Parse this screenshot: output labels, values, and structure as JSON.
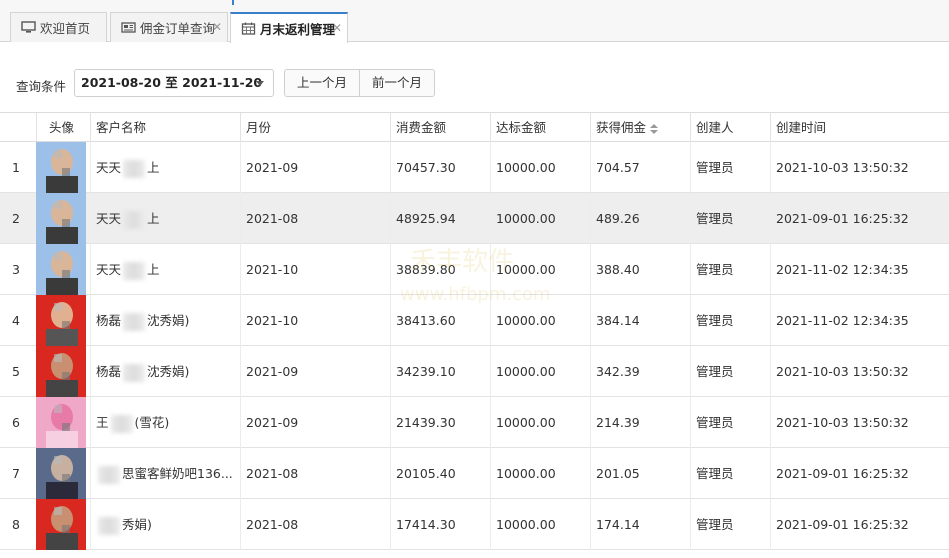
{
  "tabs": [
    {
      "label": "欢迎首页",
      "icon": "monitor-icon",
      "closable": false,
      "active": false
    },
    {
      "label": "佣金订单查询",
      "icon": "newspaper-icon",
      "closable": true,
      "active": false
    },
    {
      "label": "月末返利管理",
      "icon": "calendar-icon",
      "closable": true,
      "active": true
    }
  ],
  "toolbar": {
    "query_label": "查询条件",
    "date_range": "2021-08-20 至 2021-11-20",
    "prev_month_label": "上一个月",
    "next_month_label": "前一个月"
  },
  "table": {
    "headers": [
      "头像",
      "客户名称",
      "月份",
      "消费金额",
      "达标金额",
      "获得佣金",
      "创建人",
      "创建时间"
    ],
    "sorted_column": "获得佣金",
    "rows": [
      {
        "idx": "1",
        "name_a": "天天",
        "name_b": "上",
        "month": "2021-09",
        "spend": "70457.30",
        "target": "10000.00",
        "commission": "704.57",
        "creator": "管理员",
        "created": "2021-10-03 13:50:32"
      },
      {
        "idx": "2",
        "name_a": "天天",
        "name_b": "上",
        "month": "2021-08",
        "spend": "48925.94",
        "target": "10000.00",
        "commission": "489.26",
        "creator": "管理员",
        "created": "2021-09-01 16:25:32"
      },
      {
        "idx": "3",
        "name_a": "天天",
        "name_b": "上",
        "month": "2021-10",
        "spend": "38839.80",
        "target": "10000.00",
        "commission": "388.40",
        "creator": "管理员",
        "created": "2021-11-02 12:34:35"
      },
      {
        "idx": "4",
        "name_a": "杨磊",
        "name_b": "沈秀娟)",
        "month": "2021-10",
        "spend": "38413.60",
        "target": "10000.00",
        "commission": "384.14",
        "creator": "管理员",
        "created": "2021-11-02 12:34:35"
      },
      {
        "idx": "5",
        "name_a": "杨磊",
        "name_b": "沈秀娟)",
        "month": "2021-09",
        "spend": "34239.10",
        "target": "10000.00",
        "commission": "342.39",
        "creator": "管理员",
        "created": "2021-10-03 13:50:32"
      },
      {
        "idx": "6",
        "name_a": "王",
        "name_b": "(雪花)",
        "month": "2021-09",
        "spend": "21439.30",
        "target": "10000.00",
        "commission": "214.39",
        "creator": "管理员",
        "created": "2021-10-03 13:50:32"
      },
      {
        "idx": "7",
        "name_a": "",
        "name_b": "思蜜客鲜奶吧136...",
        "month": "2021-08",
        "spend": "20105.40",
        "target": "10000.00",
        "commission": "201.05",
        "creator": "管理员",
        "created": "2021-09-01 16:25:32"
      },
      {
        "idx": "8",
        "name_a": "",
        "name_b": "秀娟)",
        "month": "2021-08",
        "spend": "17414.30",
        "target": "10000.00",
        "commission": "174.14",
        "creator": "管理员",
        "created": "2021-09-01 16:25:32"
      }
    ]
  },
  "watermark_text": "www.hfbpm.com",
  "colors": {
    "accent": "#3a80c9",
    "selected_row": "#eeeeee"
  }
}
